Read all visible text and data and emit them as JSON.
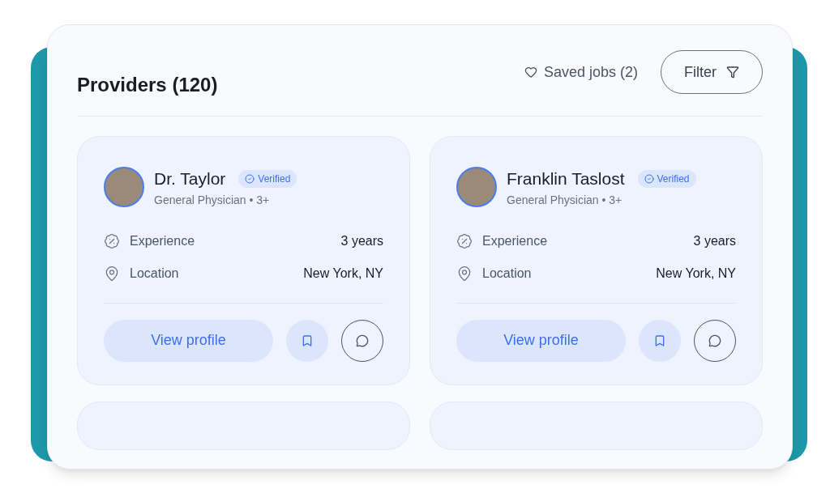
{
  "header": {
    "title": "Providers (120)",
    "saved_jobs": "Saved jobs (2)",
    "filter_button": "Filter"
  },
  "providers": [
    {
      "name": "Dr. Taylor",
      "badge": "Verified",
      "specialty": "General Physician • 3+",
      "details": [
        {
          "kind": "experience",
          "label": "Experience",
          "value": "3 years"
        },
        {
          "kind": "location",
          "label": "Location",
          "value": "New York, NY"
        }
      ],
      "action": "View profile"
    },
    {
      "name": "Franklin Taslost",
      "badge": "Verified",
      "specialty": "General Physician • 3+",
      "details": [
        {
          "kind": "experience",
          "label": "Experience",
          "value": "3 years"
        },
        {
          "kind": "location",
          "label": "Location",
          "value": "New York, NY"
        }
      ],
      "action": "View profile"
    }
  ]
}
